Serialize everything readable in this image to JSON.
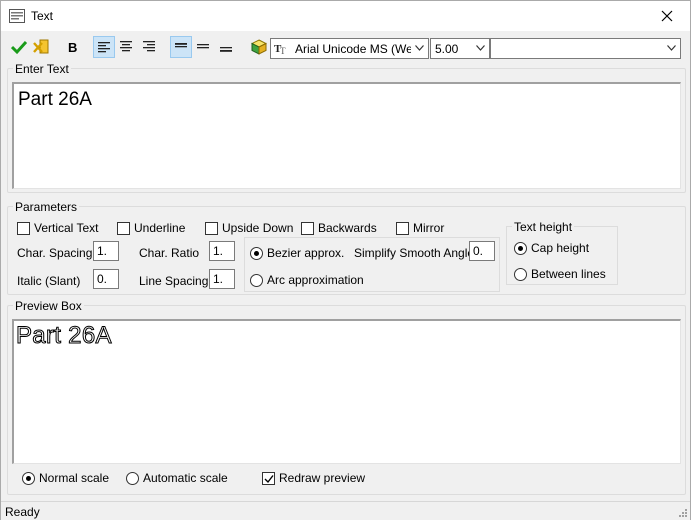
{
  "window": {
    "title": "Text"
  },
  "toolbar": {
    "font": "Arial Unicode MS (Weste",
    "size": "5.00",
    "style": ""
  },
  "enter_text": {
    "label": "Enter Text",
    "value": "Part 26A"
  },
  "parameters": {
    "label": "Parameters",
    "vertical_text": "Vertical Text",
    "underline": "Underline",
    "upside_down": "Upside Down",
    "backwards": "Backwards",
    "mirror": "Mirror",
    "char_spacing_label": "Char. Spacing",
    "char_spacing": "1.",
    "char_ratio_label": "Char. Ratio",
    "char_ratio": "1.",
    "italic_label": "Italic (Slant)",
    "italic": "0.",
    "line_spacing_label": "Line Spacing",
    "line_spacing": "1.",
    "bezier": "Bezier approx.",
    "arc": "Arc approximation",
    "simplify_label": "Simplify Smooth Angle",
    "simplify": "0.",
    "text_height_label": "Text height",
    "cap_height": "Cap height",
    "between_lines": "Between lines"
  },
  "preview": {
    "label": "Preview Box",
    "text": "Part 26A",
    "normal_scale": "Normal scale",
    "automatic_scale": "Automatic scale",
    "redraw": "Redraw preview"
  },
  "status": {
    "text": "Ready"
  }
}
